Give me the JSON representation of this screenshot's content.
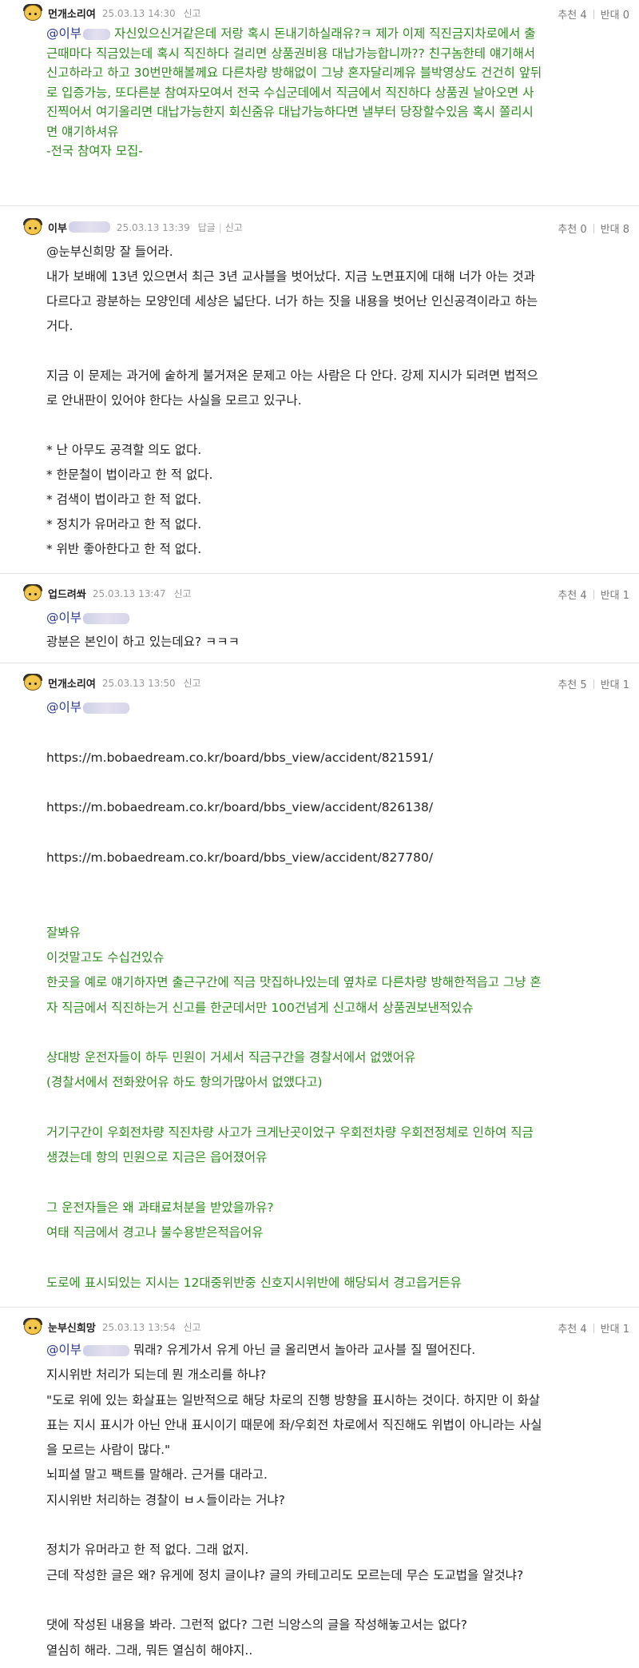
{
  "comments": [
    {
      "nick": "먼개소리여",
      "datetime": "25.03.13 14:30",
      "report": "신고",
      "up_label": "추천",
      "up_count": "4",
      "down_label": "반대",
      "down_count": "0",
      "mention": "@이부",
      "lines_green": [
        " 자신있으신거같은데 저랑 혹시 돈내기하실래유?ㅋ 제가 이제 직진금지차로에서 출",
        "근때마다 직금있는데 혹시 직진하다 걸리면 상품권비용 대납가능합니까?? 친구놈한테 얘기해서",
        "신고하라고 하고 30번만해볼께요 다른차량 방해없이 그냥 혼자달리께유 블박영상도 건건히 앞뒤",
        "로 입증가능, 또다른분 참여자모여서 전국 수십군데에서 직금에서 직진하다 상품권 날아오면 사",
        "진찍어서 여기올리면 대납가능한지 회신줌유 대납가능하다면 낼부터 당장할수있음 혹시 쫄리시",
        "면 얘기하셔유",
        "-전국 참여자 모집-"
      ]
    },
    {
      "nick": "이부",
      "datetime": "25.03.13 13:39",
      "reply": "답글",
      "report": "신고",
      "up_label": "추천",
      "up_count": "0",
      "down_label": "반대",
      "down_count": "8",
      "lines": [
        "@눈부신희망 잘 들어라.",
        "내가 보배에 13년 있으면서 최근 3년 교사블을 벗어났다. 지금 노면표지에 대해 너가 아는 것과",
        "다르다고 광분하는 모양인데 세상은 넓단다. 너가 하는 짓을 내용을 벗어난 인신공격이라고 하는",
        "거다.",
        "",
        "지금 이 문제는 과거에 숱하게 불거져온 문제고 아는 사람은 다 안다. 강제 지시가 되려면 법적으",
        "로 안내판이 있어야 한다는 사실을 모르고 있구나.",
        "",
        "* 난 아무도 공격할 의도 없다.",
        "* 한문철이 법이라고 한 적 없다.",
        "* 검색이 법이라고 한 적 없다.",
        "* 정치가 유머라고 한 적 없다.",
        "* 위반 좋아한다고 한 적 없다."
      ]
    },
    {
      "nick": "업드려쏴",
      "datetime": "25.03.13 13:47",
      "report": "신고",
      "up_label": "추천",
      "up_count": "4",
      "down_label": "반대",
      "down_count": "1",
      "mention": "@이부",
      "lines": [
        "광분은 본인이 하고 있는데요? ㅋㅋㅋ"
      ]
    },
    {
      "nick": "먼개소리여",
      "datetime": "25.03.13 13:50",
      "report": "신고",
      "up_label": "추천",
      "up_count": "5",
      "down_label": "반대",
      "down_count": "1",
      "mention": "@이부",
      "links": [
        "https://m.bobaedream.co.kr/board/bbs_view/accident/821591/",
        "https://m.bobaedream.co.kr/board/bbs_view/accident/826138/",
        "https://m.bobaedream.co.kr/board/bbs_view/accident/827780/"
      ],
      "lines_green": [
        "잘봐유",
        "이것말고도 수십건있슈",
        "한곳을 예로 얘기하자면 출근구간에 직금 맛집하나있는데 옆차로 다른차량 방해한적읍고 그냥 혼",
        "자 직금에서 직진하는거 신고를 한군데서만 100건넘게 신고해서 상품권보낸적있슈",
        "",
        "상대방 운전자들이 하두 민원이 거세서 직금구간을 경찰서에서 없앴어유",
        "(경찰서에서 전화왔어유 하도 항의가많아서 없앴다고)",
        "",
        "거기구간이 우회전차량 직진차량 사고가 크게난곳이었구 우회전차량 우회전정체로 인하여 직금",
        "생겼는데 항의 민원으로 지금은 읍어졌어유",
        "",
        "그 운전자들은 왜 과태료처분을 받았을까유?",
        "여태 직금에서 경고나 불수용받은적읍어유",
        "",
        "도로에 표시되있는 지시는 12대중위반중 신호지시위반에 해당되서 경고읍거든유"
      ]
    },
    {
      "nick": "눈부신희망",
      "datetime": "25.03.13 13:54",
      "report": "신고",
      "up_label": "추천",
      "up_count": "4",
      "down_label": "반대",
      "down_count": "1",
      "mention": "@이부",
      "first_line_rest": " 뭐래? 유게가서 유게 아닌 글 올리면서 놀아라 교사블 질 떨어진다.",
      "lines": [
        "지시위반 처리가 되는데 뭔 개소리를 하냐?",
        "\"도로 위에 있는 화살표는 일반적으로 해당 차로의 진행 방향을 표시하는 것이다. 하지만 이 화살",
        "표는 지시 표시가 아닌 안내 표시이기 때문에 좌/우회전 차로에서 직진해도 위법이 아니라는 사실",
        "을 모르는 사람이 많다.\"",
        "뇌피셜 말고 팩트를 말해라. 근거를 대라고.",
        "지시위반 처리하는 경찰이 ㅂㅅ들이라는 거냐?",
        "",
        "정치가 유머라고 한 적 없다. 그래 없지.",
        "근데 작성한 글은 왜? 유게에 정치 글이냐? 글의 카테고리도 모르는데 무슨 도교법을 알것냐?",
        "",
        "댓에 작성된 내용을 봐라. 그런적 없다? 그런 늬앙스의 글을 작성해놓고서는 없다?",
        "열심히 해라. 그래, 뭐든 열심히 해야지.."
      ]
    }
  ]
}
